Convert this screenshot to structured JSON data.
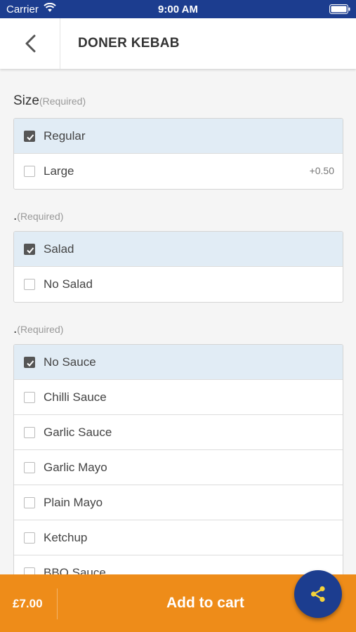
{
  "status_bar": {
    "carrier": "Carrier",
    "time": "9:00 AM"
  },
  "header": {
    "title": "DONER KEBAB"
  },
  "groups": [
    {
      "title": "Size",
      "required": "(Required)",
      "options": [
        {
          "label": "Regular",
          "checked": true,
          "price": ""
        },
        {
          "label": "Large",
          "checked": false,
          "price": "+0.50"
        }
      ]
    },
    {
      "title": ".",
      "required": "(Required)",
      "options": [
        {
          "label": "Salad",
          "checked": true
        },
        {
          "label": "No Salad",
          "checked": false
        }
      ]
    },
    {
      "title": ".",
      "required": "(Required)",
      "options": [
        {
          "label": "No Sauce",
          "checked": true
        },
        {
          "label": "Chilli Sauce",
          "checked": false
        },
        {
          "label": "Garlic Sauce",
          "checked": false
        },
        {
          "label": "Garlic Mayo",
          "checked": false
        },
        {
          "label": "Plain Mayo",
          "checked": false
        },
        {
          "label": "Ketchup",
          "checked": false
        },
        {
          "label": "BBQ Sauce",
          "checked": false
        }
      ]
    }
  ],
  "footer": {
    "total": "£7.00",
    "add_to_cart": "Add to cart"
  },
  "colors": {
    "brand_blue": "#1c3d8f",
    "accent_orange": "#ee8c19",
    "selected_row": "#e1ecf5",
    "share_icon": "#f5d33a"
  },
  "icons": {
    "back": "chevron-left-icon",
    "share": "share-icon",
    "checkbox": "check-icon"
  }
}
